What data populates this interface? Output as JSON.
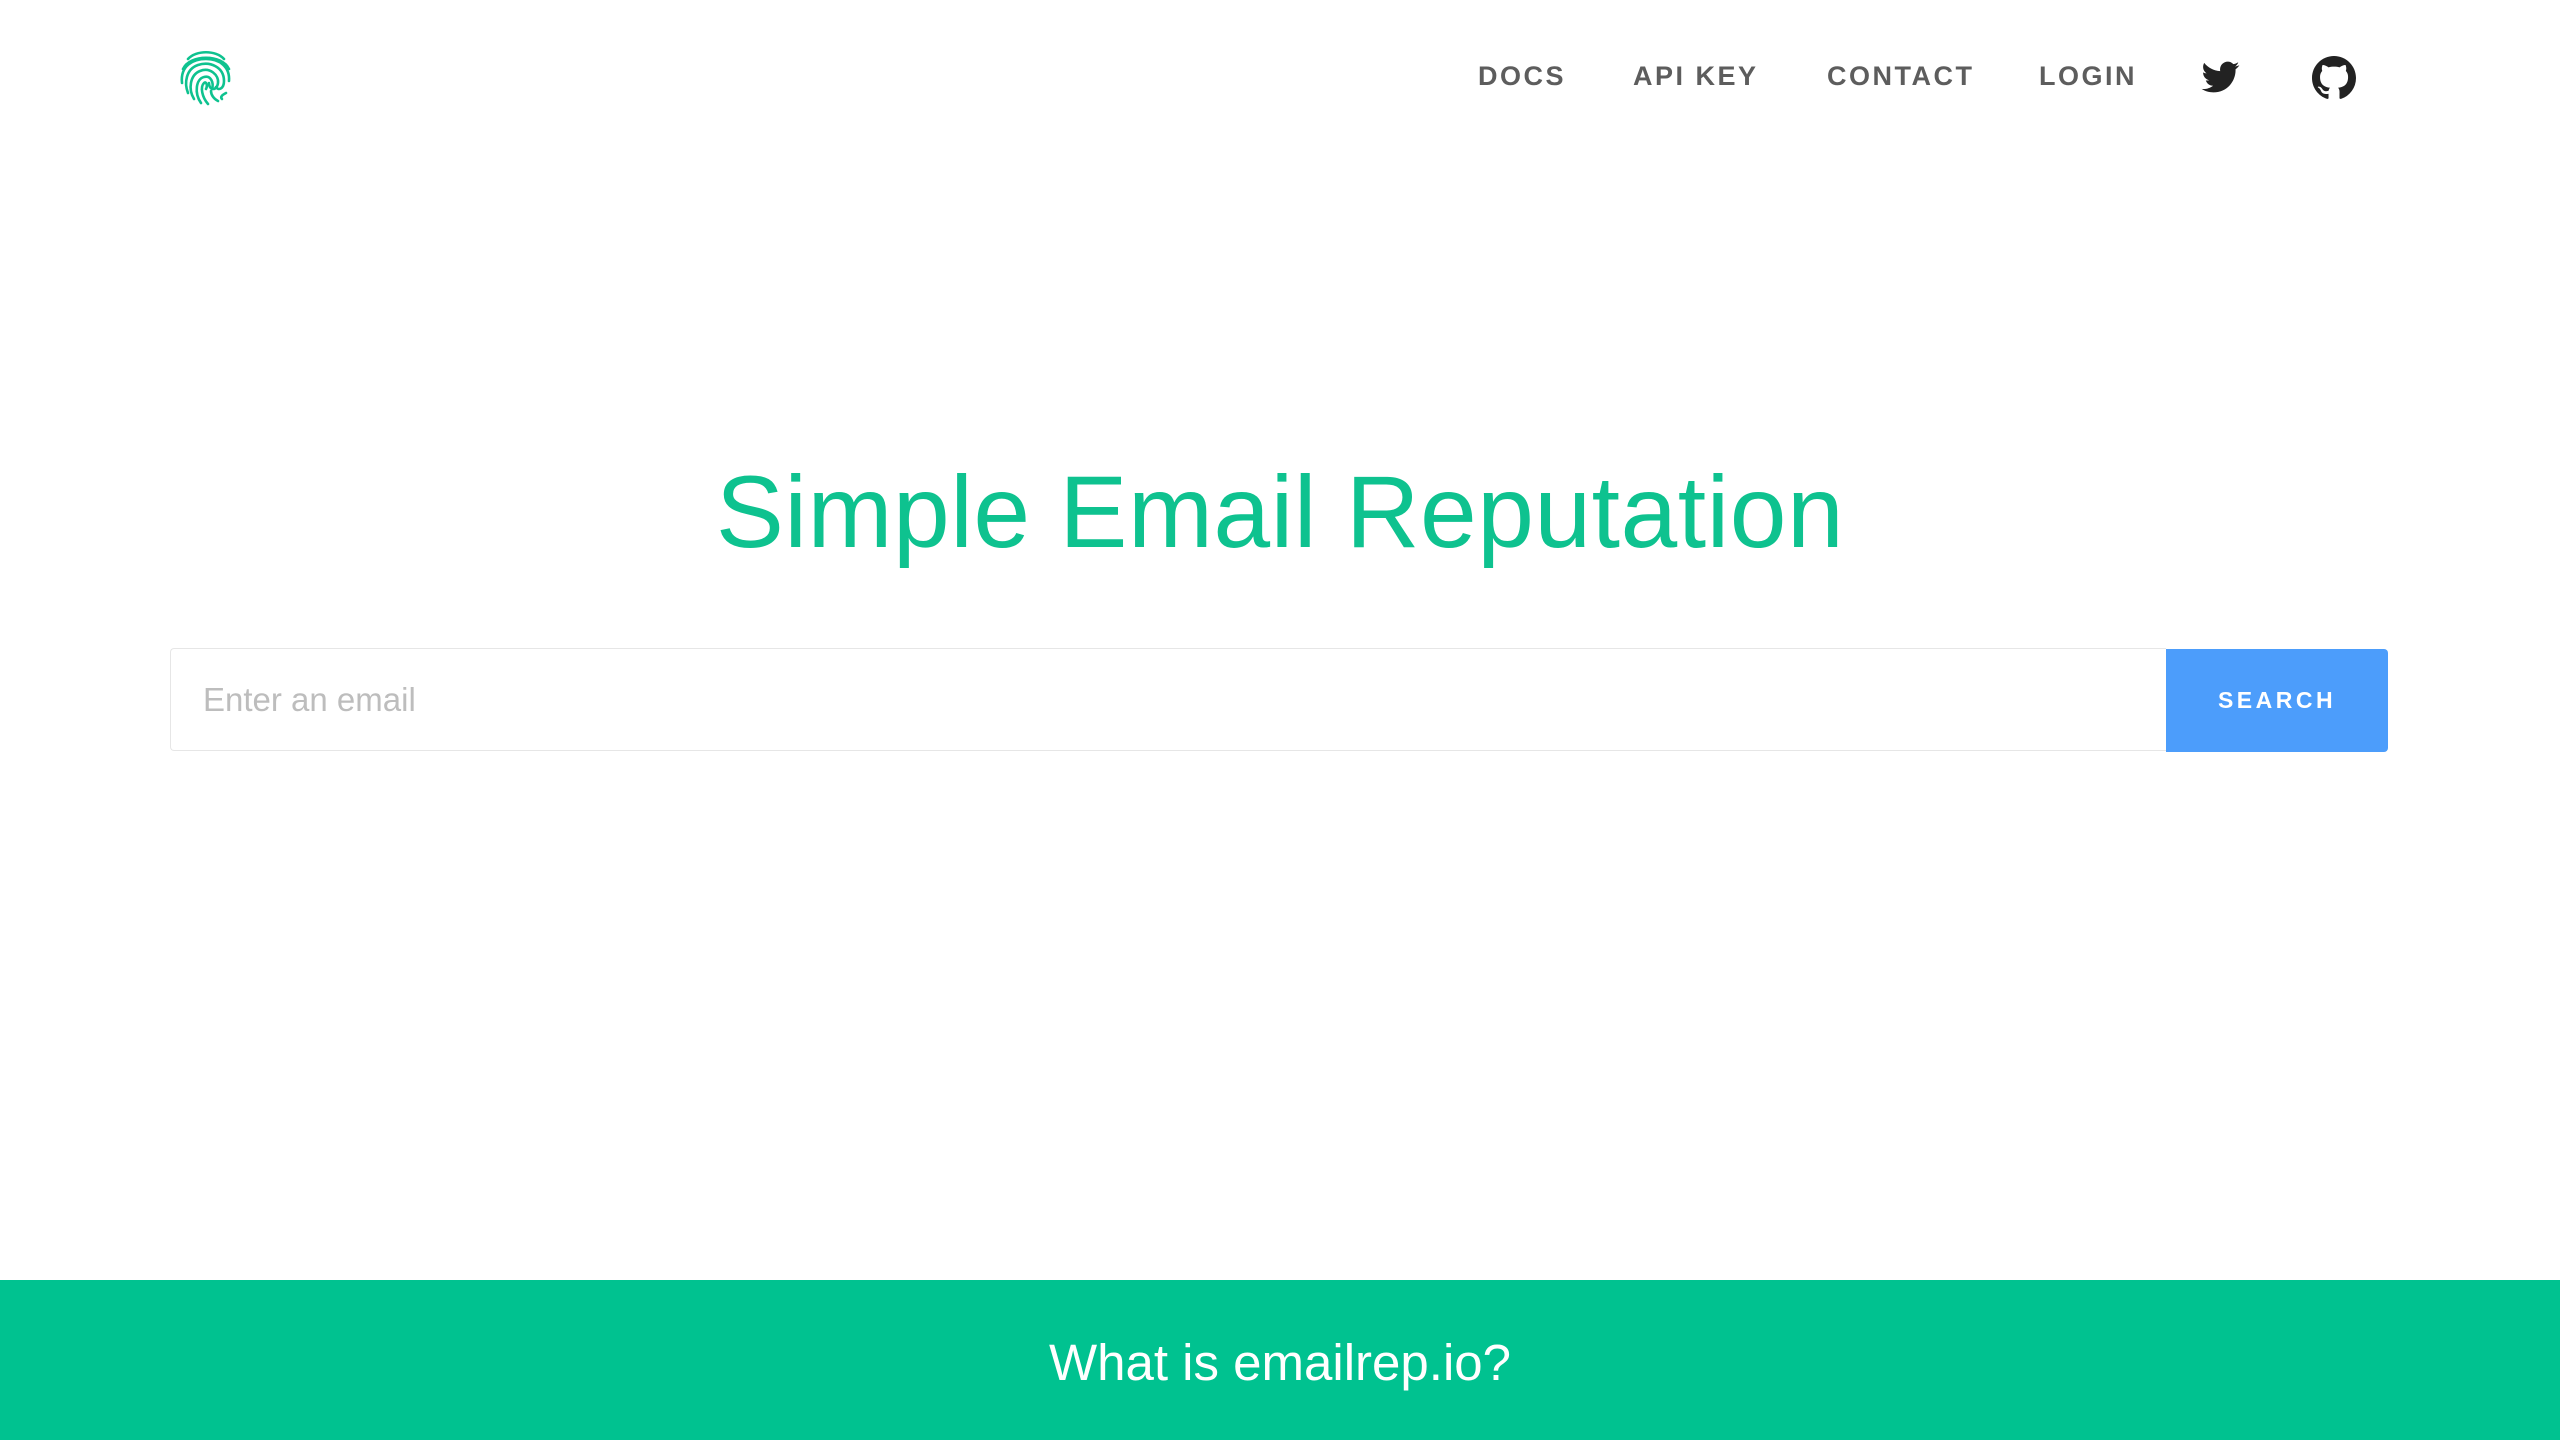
{
  "header": {
    "logo_icon": "fingerprint-icon",
    "logo_color": "#0ec28f",
    "nav": [
      {
        "label": "DOCS"
      },
      {
        "label": "API KEY"
      },
      {
        "label": "CONTACT"
      },
      {
        "label": "LOGIN"
      }
    ],
    "social": [
      {
        "icon": "twitter-icon"
      },
      {
        "icon": "github-icon"
      }
    ]
  },
  "hero": {
    "title": "Simple Email Reputation",
    "title_color": "#0ec28f",
    "search": {
      "placeholder": "Enter an email",
      "value": "",
      "button_label": "SEARCH",
      "button_color": "#4c9dfb"
    }
  },
  "band": {
    "heading": "What is emailrep.io?",
    "background": "#00c290"
  }
}
